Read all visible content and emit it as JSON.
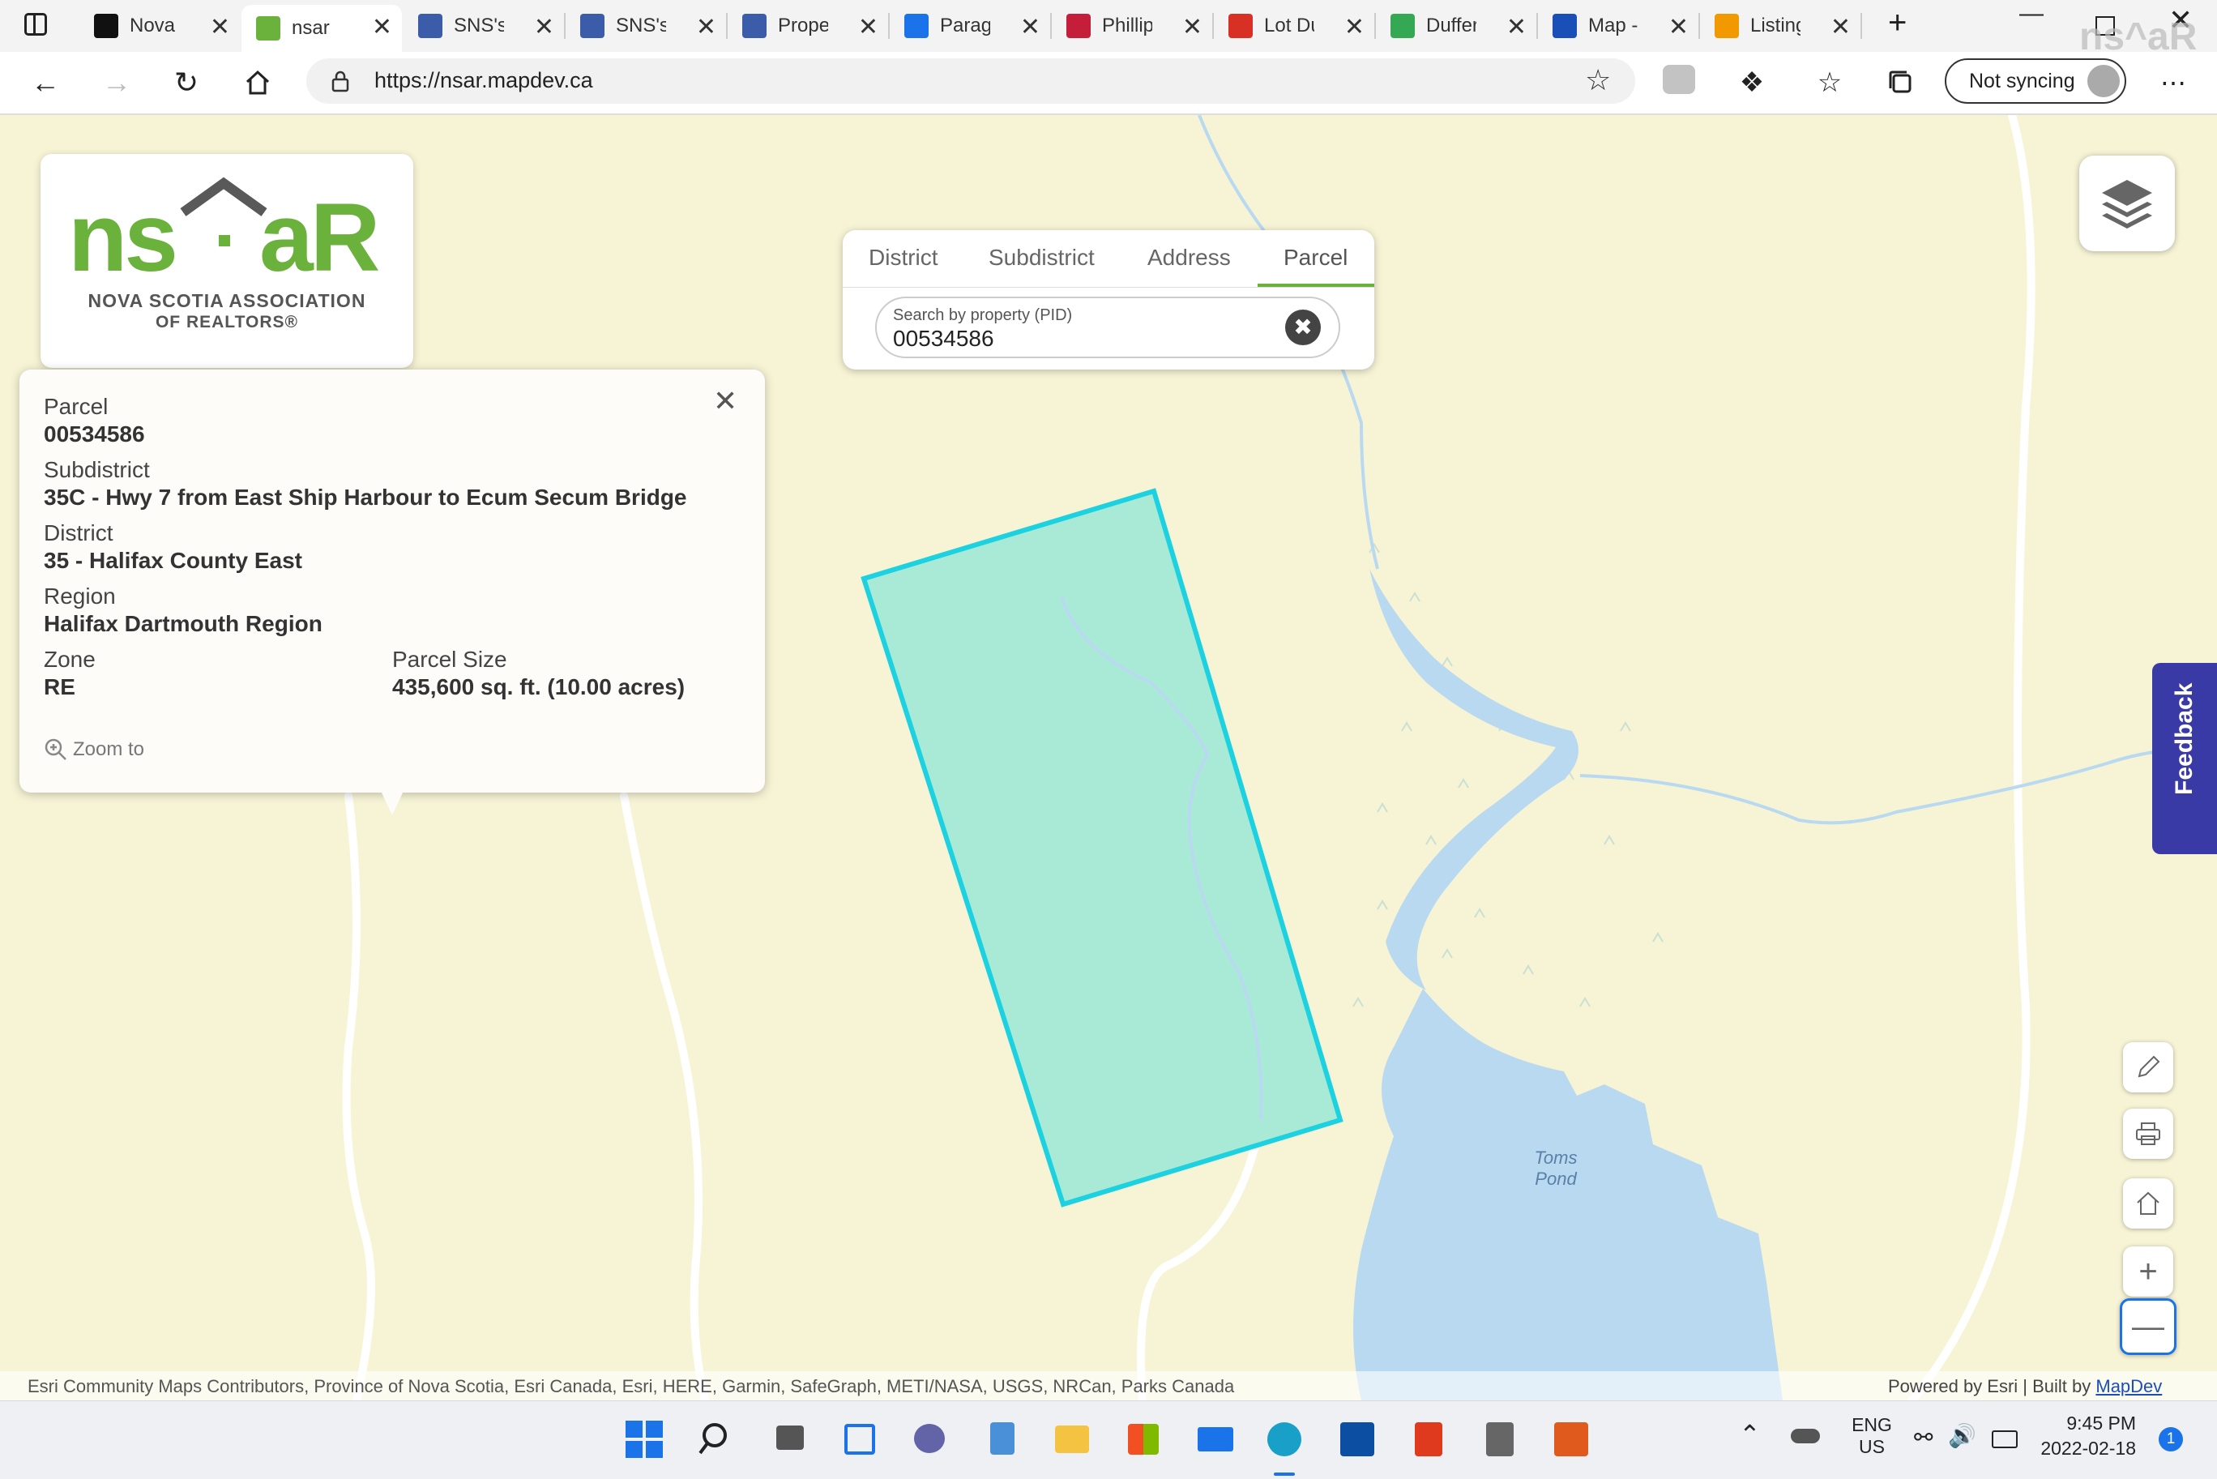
{
  "browser": {
    "tabs": [
      {
        "label": "Nova S",
        "icon": "c-logo-icon"
      },
      {
        "label": "nsar",
        "icon": "nsar-house-icon",
        "active": true
      },
      {
        "label": "SNS's",
        "icon": "sns-icon"
      },
      {
        "label": "SNS's",
        "icon": "sns-icon"
      },
      {
        "label": "Proper",
        "icon": "sns-icon"
      },
      {
        "label": "Parago",
        "icon": "paragon-icon"
      },
      {
        "label": "Phillip",
        "icon": "red-arrow-icon"
      },
      {
        "label": "Lot Du",
        "icon": "gmail-icon"
      },
      {
        "label": "Duffer",
        "icon": "maps-pin-icon"
      },
      {
        "label": "Map -",
        "icon": "map-icon"
      },
      {
        "label": "Listing",
        "icon": "listing-icon"
      }
    ],
    "url": "https://nsar.mapdev.ca",
    "sync_label": "Not syncing",
    "nsar_ghost": "ns^aR"
  },
  "logo": {
    "wordmark": "nsaR",
    "line1": "NOVA SCOTIA ASSOCIATION",
    "line2": "OF REALTORS®"
  },
  "popup": {
    "parcel_label": "Parcel",
    "parcel_value": "00534586",
    "subdistrict_label": "Subdistrict",
    "subdistrict_value": "35C - Hwy 7 from East Ship Harbour to Ecum Secum Bridge",
    "district_label": "District",
    "district_value": "35 - Halifax County East",
    "region_label": "Region",
    "region_value": "Halifax Dartmouth Region",
    "zone_label": "Zone",
    "zone_value": "RE",
    "size_label": "Parcel Size",
    "size_value": "435,600 sq. ft. (10.00 acres)",
    "zoom_label": "Zoom to"
  },
  "search": {
    "tabs": [
      "District",
      "Subdistrict",
      "Address",
      "Parcel"
    ],
    "active_tab": "Parcel",
    "field_label": "Search by property (PID)",
    "field_value": "00534586"
  },
  "map": {
    "pond_label_1": "Toms",
    "pond_label_2": "Pond",
    "attribution": "Esri Community Maps Contributors, Province of Nova Scotia, Esri Canada, Esri, HERE, Garmin, SafeGraph, METI/NASA, USGS, NRCan, Parks Canada",
    "powered_by": "Powered by Esri | Built by ",
    "built_by_link": "MapDev",
    "colors": {
      "land": "#f7f4d6",
      "water": "#b9d9f0",
      "parcel_fill": "#a9ead7",
      "parcel_stroke": "#1cd1e0"
    }
  },
  "feedback_label": "Feedback",
  "taskbar": {
    "lang_1": "ENG",
    "lang_2": "US",
    "time": "9:45 PM",
    "date": "2022-02-18",
    "notifications": "1"
  }
}
